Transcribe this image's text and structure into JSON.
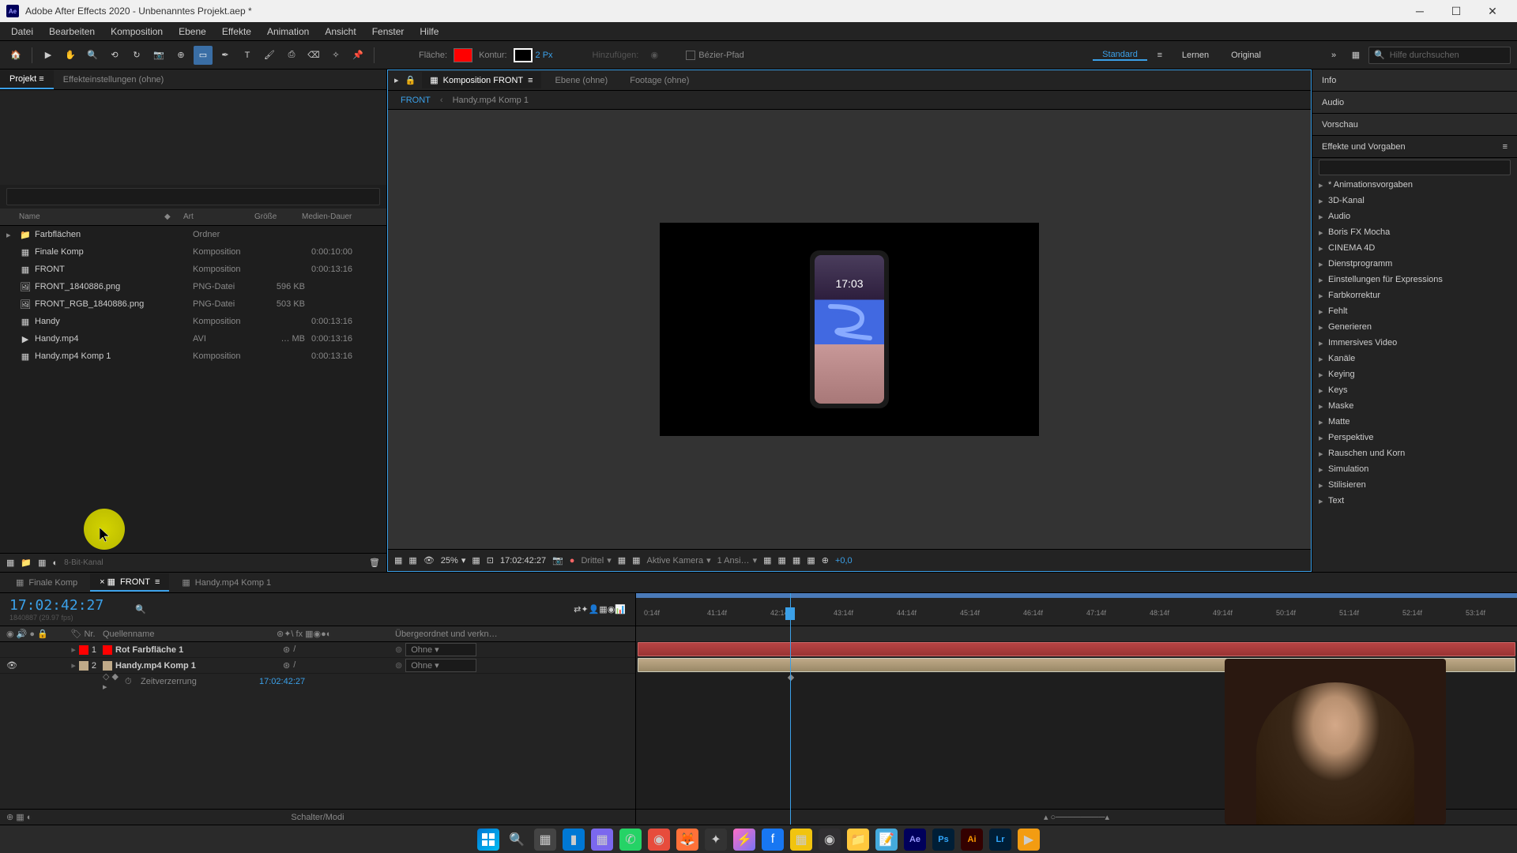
{
  "titlebar": {
    "app_name": "Ae",
    "title": "Adobe After Effects 2020 - Unbenanntes Projekt.aep *"
  },
  "menu": [
    "Datei",
    "Bearbeiten",
    "Komposition",
    "Ebene",
    "Effekte",
    "Animation",
    "Ansicht",
    "Fenster",
    "Hilfe"
  ],
  "toolbar": {
    "fill_label": "Fläche:",
    "fill_color": "#ff0000",
    "stroke_label": "Kontur:",
    "stroke_px": "2 Px",
    "add_label": "Hinzufügen:",
    "bezier_label": "Bézier-Pfad",
    "workspaces": [
      "Standard",
      "Lernen",
      "Original"
    ],
    "search_placeholder": "Hilfe durchsuchen"
  },
  "project": {
    "tab_project": "Projekt",
    "tab_effects": "Effekteinstellungen (ohne)",
    "columns": {
      "name": "Name",
      "type": "Art",
      "size": "Größe",
      "duration": "Medien-Dauer"
    },
    "items": [
      {
        "name": "Farbflächen",
        "type": "Ordner",
        "size": "",
        "duration": "",
        "icon": "folder"
      },
      {
        "name": "Finale Komp",
        "type": "Komposition",
        "size": "",
        "duration": "0:00:10:00",
        "icon": "comp"
      },
      {
        "name": "FRONT",
        "type": "Komposition",
        "size": "",
        "duration": "0:00:13:16",
        "icon": "comp"
      },
      {
        "name": "FRONT_1840886.png",
        "type": "PNG-Datei",
        "size": "596 KB",
        "duration": "",
        "icon": "image"
      },
      {
        "name": "FRONT_RGB_1840886.png",
        "type": "PNG-Datei",
        "size": "503 KB",
        "duration": "",
        "icon": "image"
      },
      {
        "name": "Handy",
        "type": "Komposition",
        "size": "",
        "duration": "0:00:13:16",
        "icon": "comp"
      },
      {
        "name": "Handy.mp4",
        "type": "AVI",
        "size": "… MB",
        "duration": "0:00:13:16",
        "icon": "video"
      },
      {
        "name": "Handy.mp4 Komp 1",
        "type": "Komposition",
        "size": "",
        "duration": "0:00:13:16",
        "icon": "comp"
      }
    ],
    "footer_bpc": "8-Bit-Kanal"
  },
  "viewer": {
    "tab_comp": "Komposition FRONT",
    "tab_layer": "Ebene (ohne)",
    "tab_footage": "Footage (ohne)",
    "breadcrumb": [
      "FRONT",
      "Handy.mp4 Komp 1"
    ],
    "phone_time": "17:03",
    "footer": {
      "zoom": "25%",
      "time": "17:02:42:27",
      "resolution": "Drittel",
      "camera": "Aktive Kamera",
      "views": "1 Ansi…",
      "exposure": "+0,0"
    }
  },
  "right_panels": {
    "info": "Info",
    "audio": "Audio",
    "preview": "Vorschau",
    "effects_header": "Effekte und Vorgaben",
    "effects": [
      "* Animationsvorgaben",
      "3D-Kanal",
      "Audio",
      "Boris FX Mocha",
      "CINEMA 4D",
      "Dienstprogramm",
      "Einstellungen für Expressions",
      "Farbkorrektur",
      "Fehlt",
      "Generieren",
      "Immersives Video",
      "Kanäle",
      "Keying",
      "Keys",
      "Maske",
      "Matte",
      "Perspektive",
      "Rauschen und Korn",
      "Simulation",
      "Stilisieren",
      "Text"
    ]
  },
  "timeline": {
    "tabs": [
      "Finale Komp",
      "FRONT",
      "Handy.mp4 Komp 1"
    ],
    "active_tab": 1,
    "timecode": "17:02:42:27",
    "timecode_sub": "1840887 (29.97 fps)",
    "col_num": "Nr.",
    "col_name": "Quellenname",
    "col_parent": "Übergeordnet und verkn…",
    "layers": [
      {
        "num": "1",
        "name": "Rot Farbfläche 1",
        "color": "#ff0000",
        "parent": "Ohne"
      },
      {
        "num": "2",
        "name": "Handy.mp4 Komp 1",
        "color": "#bfa988",
        "parent": "Ohne"
      }
    ],
    "prop_name": "Zeitverzerrung",
    "prop_value": "17:02:42:27",
    "ruler_ticks": [
      "0:14f",
      "41:14f",
      "42:14f",
      "43:14f",
      "44:14f",
      "45:14f",
      "46:14f",
      "47:14f",
      "48:14f",
      "49:14f",
      "50:14f",
      "51:14f",
      "52:14f",
      "53:14f"
    ],
    "footer_label": "Schalter/Modi"
  }
}
